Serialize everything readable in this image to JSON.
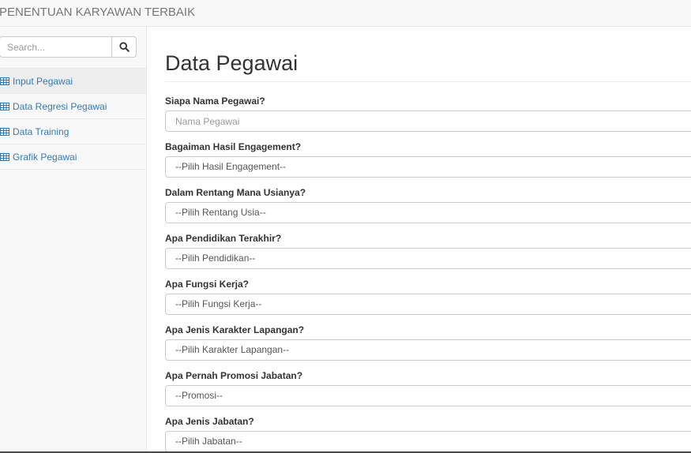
{
  "navbar": {
    "brand": "PENENTUAN KARYAWAN TERBAIK"
  },
  "sidebar": {
    "search": {
      "placeholder": "Search...",
      "icon": "search-icon"
    },
    "items": [
      {
        "label": "Input Pegawai",
        "icon": "table-icon",
        "active": true
      },
      {
        "label": "Data Regresi Pegawai",
        "icon": "table-icon"
      },
      {
        "label": "Data Training",
        "icon": "table-icon"
      },
      {
        "label": "Grafik Pegawai",
        "icon": "table-icon"
      }
    ]
  },
  "main": {
    "title": "Data Pegawai",
    "fields": [
      {
        "label": "Siapa Nama Pegawai?",
        "placeholder": "Nama Pegawai"
      },
      {
        "label": "Bagaiman Hasil Engagement?",
        "value": "--Pilih Hasil Engagement--"
      },
      {
        "label": "Dalam Rentang Mana Usianya?",
        "value": "--Pilih Rentang Usia--"
      },
      {
        "label": "Apa Pendidikan Terakhir?",
        "value": "--Pilih Pendidikan--"
      },
      {
        "label": "Apa Fungsi Kerja?",
        "value": "--Pilih Fungsi Kerja--"
      },
      {
        "label": "Apa Jenis Karakter Lapangan?",
        "value": "--Pilih Karakter Lapangan--"
      },
      {
        "label": "Apa Pernah Promosi Jabatan?",
        "value": "--Promosi--"
      },
      {
        "label": "Apa Jenis Jabatan?",
        "value": "--Pilih Jabatan--"
      }
    ]
  },
  "colors": {
    "link": "#337ab7",
    "navbar_bg": "#f8f8f8",
    "border": "#e7e7e7",
    "active_item_bg": "#eeeeee"
  }
}
